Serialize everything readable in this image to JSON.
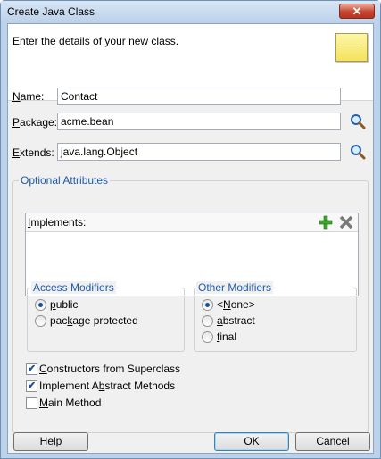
{
  "window": {
    "title": "Create Java Class",
    "close_glyph": "✕"
  },
  "header": {
    "instruction": "Enter the details of your new class.",
    "icon": "note-icon"
  },
  "fields": {
    "name": {
      "label_pre": "",
      "label_mn": "N",
      "label_post": "ame:",
      "value": "Contact"
    },
    "package": {
      "label_pre": "",
      "label_mn": "P",
      "label_post": "ackage:",
      "value": "acme.bean"
    },
    "extends": {
      "label_pre": "",
      "label_mn": "E",
      "label_post": "xtends:",
      "value": "java.lang.Object"
    }
  },
  "optional": {
    "title": "Optional Attributes",
    "implements_label_pre": "",
    "implements_label_mn": "I",
    "implements_label_post": "mplements:"
  },
  "access": {
    "title": "Access Modifiers",
    "public": {
      "pre": "",
      "mn": "p",
      "post": "ublic"
    },
    "package_protected": {
      "pre": "pac",
      "mn": "k",
      "post": "age protected"
    },
    "selected": "public"
  },
  "other": {
    "title": "Other Modifiers",
    "none": {
      "pre": "<",
      "mn": "N",
      "post": "one>"
    },
    "abstract": {
      "pre": "",
      "mn": "a",
      "post": "bstract"
    },
    "final": {
      "pre": "",
      "mn": "f",
      "post": "inal"
    },
    "selected": "none"
  },
  "options": {
    "constructors": {
      "pre": "",
      "mn": "C",
      "post": "onstructors from Superclass",
      "checked": true,
      "mark": "✔"
    },
    "implement_abstract": {
      "pre": "Implement A",
      "mn": "b",
      "post": "stract Methods",
      "checked": true,
      "mark": "✔"
    },
    "main_method": {
      "pre": "",
      "mn": "M",
      "post": "ain Method",
      "checked": false,
      "mark": ""
    }
  },
  "buttons": {
    "help": {
      "pre": "",
      "mn": "H",
      "post": "elp"
    },
    "ok": "OK",
    "cancel": "Cancel"
  },
  "colors": {
    "group_title": "#1e5aa8",
    "add_icon": "#3aa52a",
    "remove_icon": "#7a7a7a"
  }
}
